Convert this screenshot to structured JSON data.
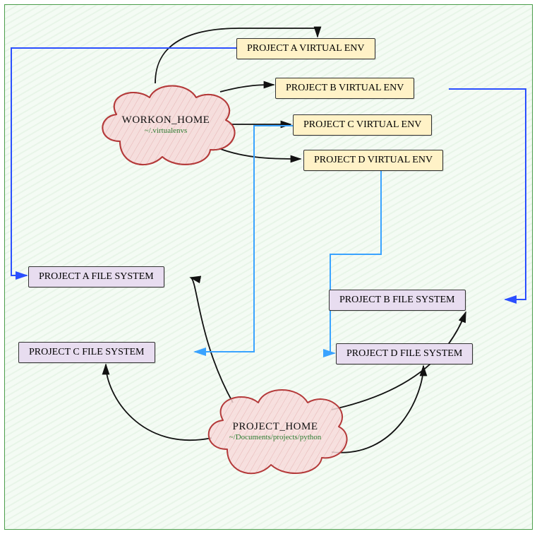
{
  "workon_home": {
    "title": "WORKON_HOME",
    "path": "~/.virtualenvs"
  },
  "project_home": {
    "title": "PROJECT_HOME",
    "path": "~/Documents/projects/python"
  },
  "venvs": {
    "a": "PROJECT A VIRTUAL ENV",
    "b": "PROJECT B VIRTUAL ENV",
    "c": "PROJECT C VIRTUAL ENV",
    "d": "PROJECT D VIRTUAL ENV"
  },
  "filesystems": {
    "a": "PROJECT A FILE SYSTEM",
    "b": "PROJECT B FILE SYSTEM",
    "c": "PROJECT C FILE SYSTEM",
    "d": "PROJECT D FILE SYSTEM"
  },
  "colors": {
    "accent_blue": "#2b4fff",
    "accent_lightblue": "#3aa3ff",
    "stroke": "#111",
    "cloud_fill": "#f7dada",
    "cloud_stroke": "#b43a3a",
    "venv_fill": "#fff2c7",
    "fs_fill": "#e8ddf0"
  }
}
